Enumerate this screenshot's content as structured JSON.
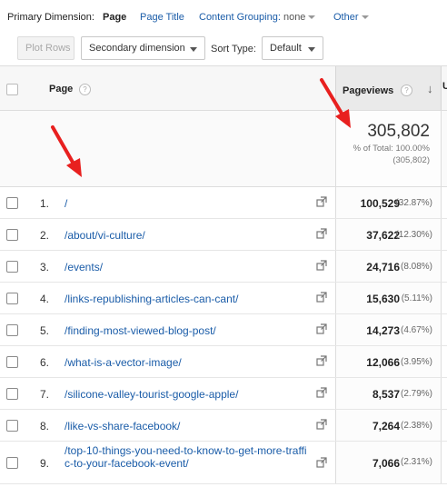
{
  "dimension_bar": {
    "label": "Primary Dimension:",
    "page": "Page",
    "page_title": "Page Title",
    "content_grouping": "Content Grouping:",
    "content_grouping_value": "none",
    "other": "Other"
  },
  "toolbar": {
    "plot_rows": "Plot Rows",
    "secondary_dimension": "Secondary dimension",
    "sort_type_label": "Sort Type:",
    "sort_type_value": "Default"
  },
  "table": {
    "col_page": "Page",
    "col_pageviews": "Pageviews",
    "help_glyph": "?",
    "sort_glyph": "↓",
    "next_col_glyph": "U",
    "totals": {
      "value": "305,802",
      "pct_label": "% of Total: 100.00%",
      "pct_abs": "(305,802)"
    },
    "rows": [
      {
        "idx": "1.",
        "page": "/",
        "pageviews": "100,529",
        "pct": "(32.87%)"
      },
      {
        "idx": "2.",
        "page": "/about/vi-culture/",
        "pageviews": "37,622",
        "pct": "(12.30%)"
      },
      {
        "idx": "3.",
        "page": "/events/",
        "pageviews": "24,716",
        "pct": "(8.08%)"
      },
      {
        "idx": "4.",
        "page": "/links-republishing-articles-can-cant/",
        "pageviews": "15,630",
        "pct": "(5.11%)"
      },
      {
        "idx": "5.",
        "page": "/finding-most-viewed-blog-post/",
        "pageviews": "14,273",
        "pct": "(4.67%)"
      },
      {
        "idx": "6.",
        "page": "/what-is-a-vector-image/",
        "pageviews": "12,066",
        "pct": "(3.95%)"
      },
      {
        "idx": "7.",
        "page": "/silicone-valley-tourist-google-apple/",
        "pageviews": "8,537",
        "pct": "(2.79%)"
      },
      {
        "idx": "8.",
        "page": "/like-vs-share-facebook/",
        "pageviews": "7,264",
        "pct": "(2.38%)"
      },
      {
        "idx": "9.",
        "page": "/top-10-things-you-need-to-know-to-get-more-traffic-to-your-facebook-event/",
        "pageviews": "7,066",
        "pct": "(2.31%)"
      }
    ]
  },
  "colors": {
    "link": "#1a5ca8",
    "annotation_arrow": "#e8201f"
  }
}
